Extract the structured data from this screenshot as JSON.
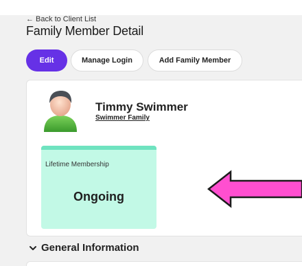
{
  "header": {
    "back_link": "← Back to Client List",
    "title": "Family Member Detail"
  },
  "toolbar": {
    "edit_label": "Edit",
    "manage_login_label": "Manage Login",
    "add_family_member_label": "Add Family Member",
    "accent_color": "#6631e6"
  },
  "member": {
    "name": "Timmy Swimmer",
    "family": "Swimmer Family",
    "avatar_icon": "user-avatar-icon"
  },
  "membership": {
    "label": "Lifetime Membership",
    "status": "Ongoing",
    "color": "#c2f9e6"
  },
  "annotation": {
    "icon": "arrow-left-icon",
    "color": "#ff4fd0"
  },
  "sections": [
    {
      "title": "General Information",
      "icon": "chevron-down-icon"
    }
  ]
}
